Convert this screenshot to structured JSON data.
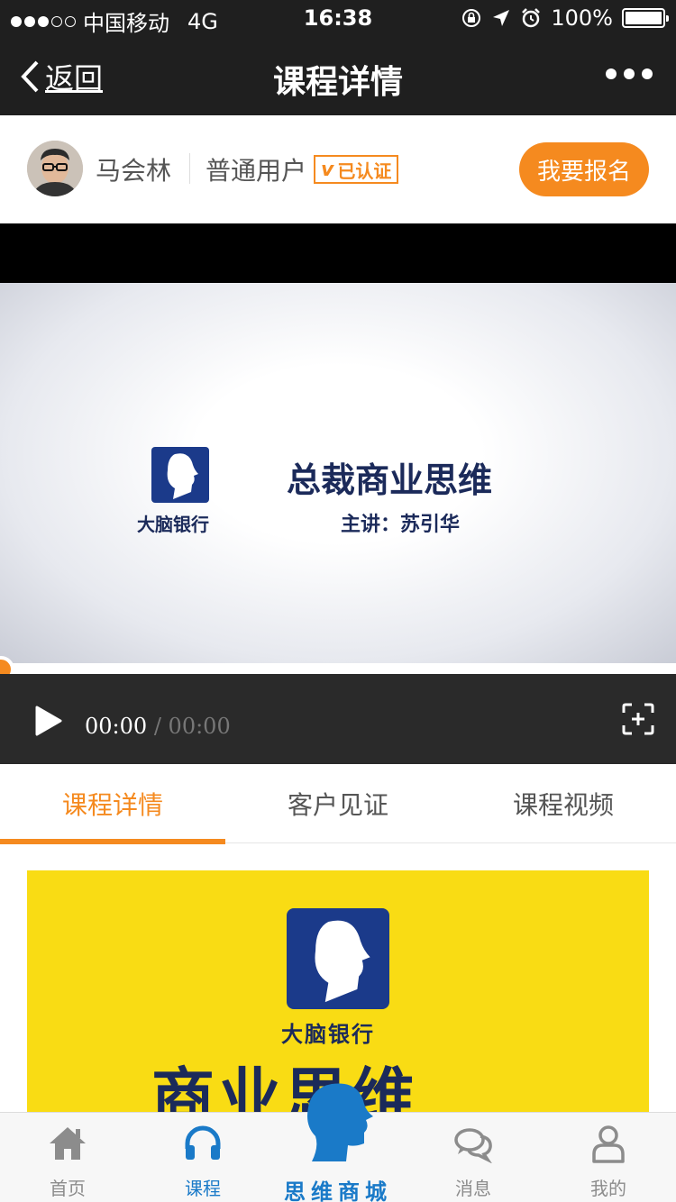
{
  "status_bar": {
    "carrier": "中国移动",
    "network": "4G",
    "time": "16:38",
    "battery": "100%"
  },
  "nav": {
    "back_label": "返回",
    "title": "课程详情"
  },
  "user": {
    "name": "马会林",
    "role": "普通用户",
    "verified_label": "已认证",
    "verified_mark": "v",
    "enroll_label": "我要报名"
  },
  "video": {
    "brand": "大脑银行",
    "title": "总裁商业思维",
    "speaker": "主讲：苏引华",
    "current_time": "00:00",
    "separator": "/",
    "total_time": "00:00",
    "progress": 0
  },
  "tabs": [
    {
      "label": "课程详情",
      "active": true
    },
    {
      "label": "客户见证",
      "active": false
    },
    {
      "label": "课程视频",
      "active": false
    }
  ],
  "banner": {
    "brand": "大脑银行",
    "title": "商业思维"
  },
  "tabbar": {
    "home": "首页",
    "course": "课程",
    "center": "思维商城",
    "messages": "消息",
    "mine": "我的"
  },
  "colors": {
    "accent": "#f58a1f",
    "tab_active_blue": "#1a7ac8",
    "brand_navy": "#1b3a8a",
    "banner_yellow": "#f9dc14",
    "nav_background": "#1f1f1f"
  }
}
